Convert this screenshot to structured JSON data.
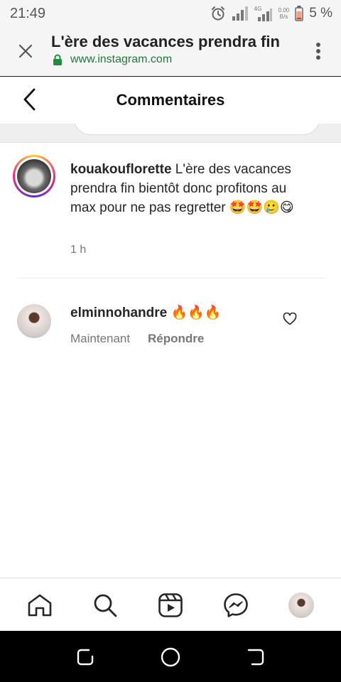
{
  "status_bar": {
    "time": "21:49",
    "network_type": "4G",
    "speed_value": "0.00",
    "speed_unit": "B/s",
    "battery": "5 %"
  },
  "browser": {
    "title": "L'ère des vacances prendra fin",
    "url": "www.instagram.com"
  },
  "header": {
    "title": "Commentaires"
  },
  "caption": {
    "username": "kouakouflorette",
    "text": " L'ère des vacances prendra fin bientôt donc profitons au max pour ne pas regretter 🤩🤩🥲😋",
    "time": "1 h"
  },
  "comments": [
    {
      "username": "elminnohandre",
      "text": " 🔥🔥🔥",
      "time": "Maintenant",
      "reply_label": "Répondre"
    }
  ],
  "colors": {
    "url_green": "#1f7a3a",
    "lock_green": "#1e8e3e",
    "story_gradient": [
      "#f9ce34",
      "#ee2a7b",
      "#6228d7"
    ]
  },
  "icons": {
    "status": [
      "alarm-icon",
      "signal-icon",
      "battery-low-icon"
    ],
    "browser": [
      "close-icon",
      "lock-icon",
      "more-vert-icon"
    ],
    "header": [
      "back-chevron-icon"
    ],
    "comment": [
      "heart-outline-icon"
    ],
    "bottom_nav": [
      "home-icon",
      "search-icon",
      "reels-icon",
      "messenger-icon",
      "profile-avatar"
    ],
    "android_nav": [
      "recents-icon",
      "home-circle-icon",
      "back-icon"
    ]
  }
}
